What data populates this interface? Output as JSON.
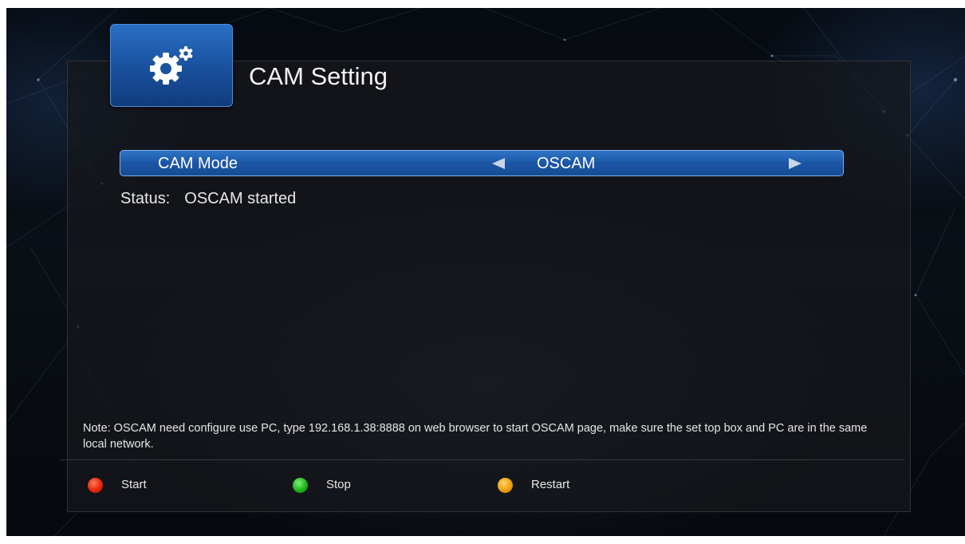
{
  "header": {
    "title": "CAM Setting",
    "icon": "gears-icon"
  },
  "cam_mode": {
    "label": "CAM Mode",
    "value": "OSCAM",
    "prev_icon": "arrow-left-icon",
    "next_icon": "arrow-right-icon"
  },
  "status": {
    "label": "Status:",
    "value": "OSCAM started"
  },
  "note": {
    "text": "Note: OSCAM need configure use PC, type 192.168.1.38:8888 on web browser to start OSCAM page, make sure the set top box and PC are in the same local network."
  },
  "keys": [
    {
      "label": "Start",
      "color": "#e8260a"
    },
    {
      "label": "Stop",
      "color": "#1fb41c"
    },
    {
      "label": "Restart",
      "color": "#f0a010"
    }
  ],
  "colors": {
    "accent": "#1b56a6",
    "background": "#0a0f16"
  }
}
